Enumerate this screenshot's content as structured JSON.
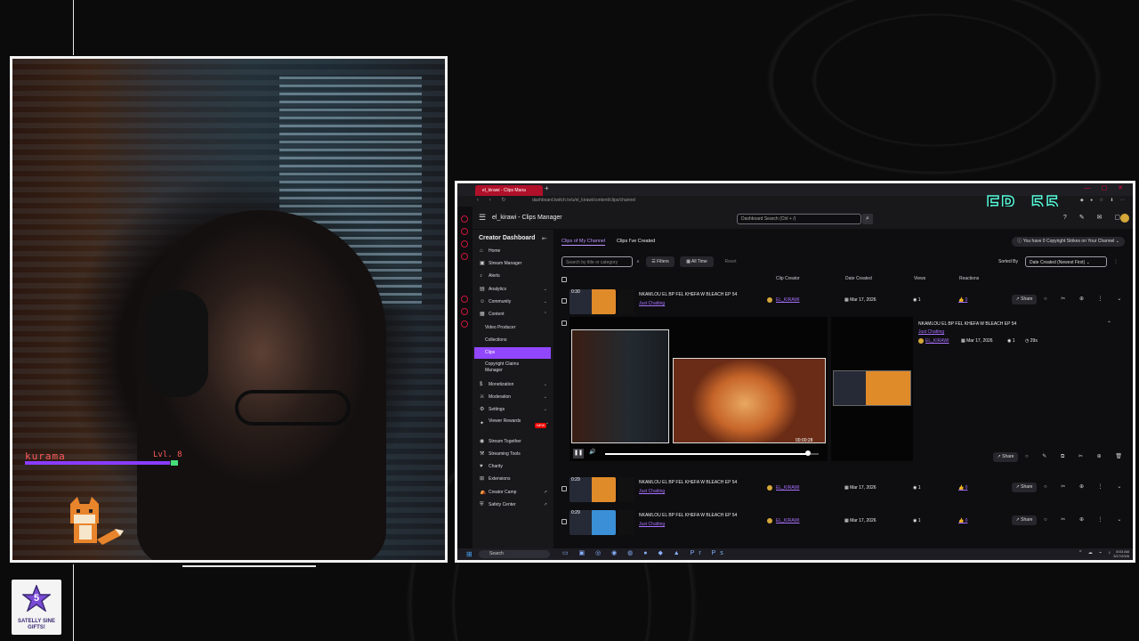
{
  "overlay": {
    "webcam_name": "kurama",
    "webcam_level": "Lvl. 8",
    "xp_progress": 0.95,
    "logo_text": "SATELLY SINE GIFTS!",
    "episode_badge": "EP 55"
  },
  "browser": {
    "tab_title": "el_kirawi - Clips Mana",
    "url": "dashboard.twitch.tv/u/el_kirawi/content/clips/channel"
  },
  "header": {
    "page_title": "el_kirawi - Clips Manager",
    "search_placeholder": "Dashboard Search (Ctrl + /)"
  },
  "sidebar": {
    "title": "Creator Dashboard",
    "items": [
      {
        "label": "Home",
        "icon": "home-icon"
      },
      {
        "label": "Stream Manager",
        "icon": "stream-manager-icon"
      },
      {
        "label": "Alerts",
        "icon": "alerts-icon"
      },
      {
        "label": "Analytics",
        "icon": "analytics-icon"
      },
      {
        "label": "Community",
        "icon": "community-icon"
      },
      {
        "label": "Content",
        "icon": "content-icon"
      },
      {
        "label": "Video Producer"
      },
      {
        "label": "Collections"
      },
      {
        "label": "Clips"
      },
      {
        "label": "Copyright Claims Manager"
      },
      {
        "label": "Monetization",
        "icon": "monetization-icon"
      },
      {
        "label": "Moderation",
        "icon": "moderation-icon"
      },
      {
        "label": "Settings",
        "icon": "settings-icon"
      },
      {
        "label": "Viewer Rewards",
        "icon": "viewer-rewards-icon",
        "badge": "NEW"
      },
      {
        "label": "Stream Together",
        "icon": "stream-together-icon"
      },
      {
        "label": "Streaming Tools",
        "icon": "streaming-tools-icon"
      },
      {
        "label": "Charity",
        "icon": "charity-icon"
      },
      {
        "label": "Extensions",
        "icon": "extensions-icon"
      },
      {
        "label": "Creator Camp",
        "icon": "creator-camp-icon"
      },
      {
        "label": "Safety Center",
        "icon": "safety-center-icon"
      }
    ]
  },
  "clips": {
    "tab_mine": "Clips of My Channel",
    "tab_created": "Clips I've Created",
    "copyright_notice": "You have 0 Copyright Strikes on Your Channel",
    "search_placeholder": "Search by title or category",
    "filters_label": "Filters",
    "all_time_label": "All Time",
    "reset_label": "Reset",
    "sorted_by_label": "Sorted By",
    "sort_value": "Date Created (Newest First)",
    "columns": {
      "creator": "Clip Creator",
      "date": "Date Created",
      "views": "Views",
      "reactions": "Reactions"
    },
    "share_label": "Share",
    "rows": [
      {
        "duration": "0:30",
        "title": "NKAMLOU EL BP FEL KHEFA W BLEACH EP 54",
        "category": "Just Chatting",
        "creator": "EL_KIRAWI",
        "date": "Mar 17, 2026",
        "views": "1",
        "reactions": "0"
      },
      {
        "duration": "0:29",
        "title": "NKAMLOU EL BP FEL KHEFA W BLEACH EP 54",
        "category": "Just Chatting",
        "creator": "EL_KIRAWI",
        "date": "Mar 17, 2026",
        "views": "1",
        "reactions": "0"
      },
      {
        "duration": "0:29",
        "title": "NKAMLOU EL BP FEL KHEFA W BLEACH EP 54",
        "category": "Just Chatting",
        "creator": "EL_KIRAWI",
        "date": "Mar 17, 2026",
        "views": "1",
        "reactions": "0"
      }
    ],
    "expanded": {
      "title": "NKAMLOU EL BP FEL KHEFA W BLEACH EP 54",
      "category": "Just Chatting",
      "creator": "EL_KIRAWI",
      "date": "Mar 17, 2026",
      "views": "1",
      "duration": "29s",
      "player_time": "00:00:28",
      "playback_progress": 0.95
    }
  },
  "taskbar": {
    "search_label": "Search",
    "time": "8:03 AM",
    "date": "3/17/2026"
  }
}
